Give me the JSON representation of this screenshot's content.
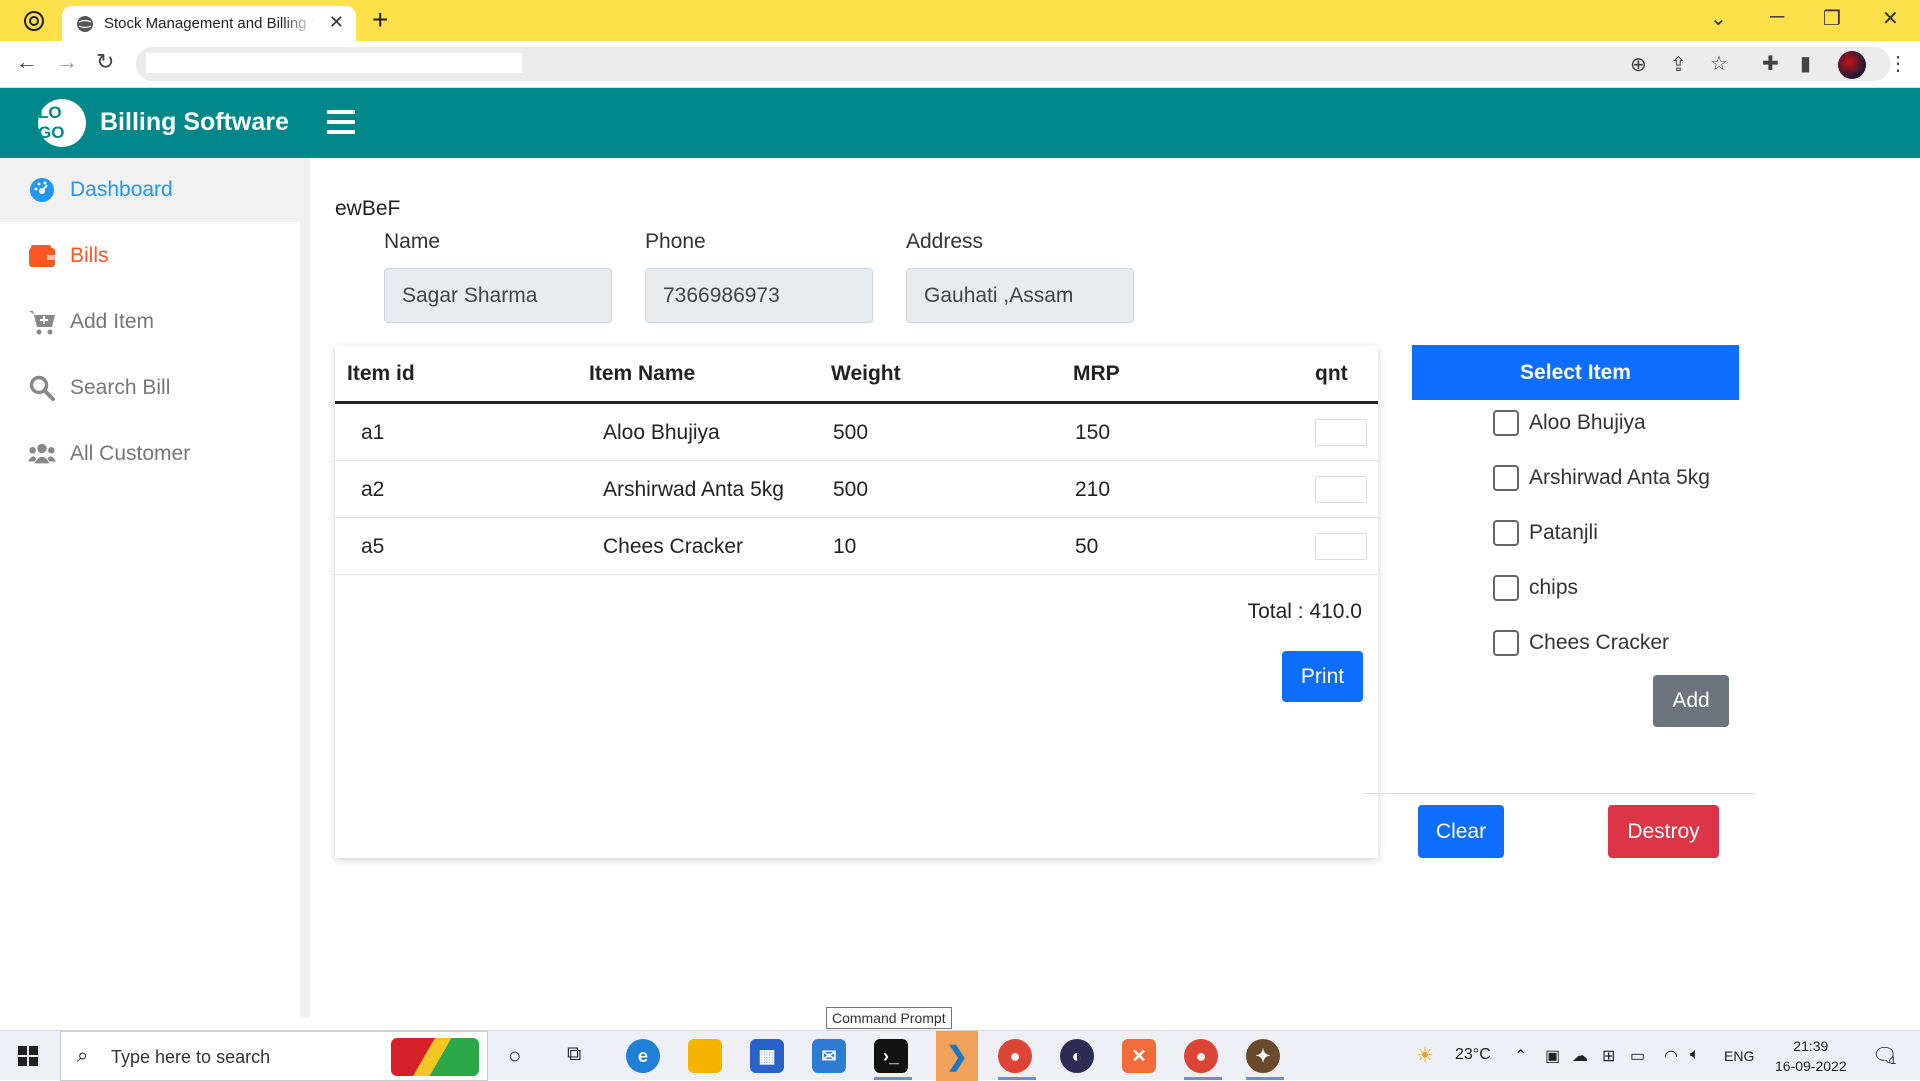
{
  "browser": {
    "tab_title": "Stock Management and Billing Software",
    "tab_close": "✕",
    "new_tab": "+",
    "url": ""
  },
  "app": {
    "logo_text": "LO GO",
    "title": "Billing Software"
  },
  "sidebar": {
    "items": [
      {
        "label": "Dashboard",
        "icon": "gauge-icon"
      },
      {
        "label": "Bills",
        "icon": "wallet-icon"
      },
      {
        "label": "Add Item",
        "icon": "cart-plus-icon"
      },
      {
        "label": "Search Bill",
        "icon": "search-icon"
      },
      {
        "label": "All Customer",
        "icon": "users-icon"
      }
    ]
  },
  "form": {
    "heading": "ewBeF",
    "name_label": "Name",
    "name_value": "Sagar Sharma",
    "phone_label": "Phone",
    "phone_value": "7366986973",
    "address_label": "Address",
    "address_value": "Gauhati ,Assam"
  },
  "table": {
    "headers": [
      "Item id",
      "Item Name",
      "Weight",
      "MRP",
      "qnt"
    ],
    "rows": [
      {
        "id": "a1",
        "name": "Aloo Bhujiya",
        "weight": "500",
        "mrp": "150"
      },
      {
        "id": "a2",
        "name": "Arshirwad Anta 5kg",
        "weight": "500",
        "mrp": "210"
      },
      {
        "id": "a5",
        "name": "Chees Cracker",
        "weight": "10",
        "mrp": "50"
      }
    ],
    "total": "Total : 410.0",
    "print_label": "Print"
  },
  "select_panel": {
    "header": "Select Item",
    "items": [
      "Aloo Bhujiya",
      "Arshirwad Anta 5kg",
      "Patanjli",
      "chips",
      "Chees Cracker"
    ],
    "add_label": "Add",
    "clear_label": "Clear",
    "destroy_label": "Destroy"
  },
  "tooltip": "Command Prompt",
  "taskbar": {
    "search_placeholder": "Type here to search",
    "weather": "23°C",
    "language": "ENG",
    "time": "21:39",
    "date": "16-09-2022",
    "notification_count": "1"
  },
  "colors": {
    "header_bg": "#00878a",
    "primary": "#0d6efd",
    "danger": "#dc3545",
    "secondary": "#6c757d",
    "dashboard_active": "#2196f3",
    "bills_accent": "#ff5722",
    "tabbar_bg": "#fde04a"
  }
}
